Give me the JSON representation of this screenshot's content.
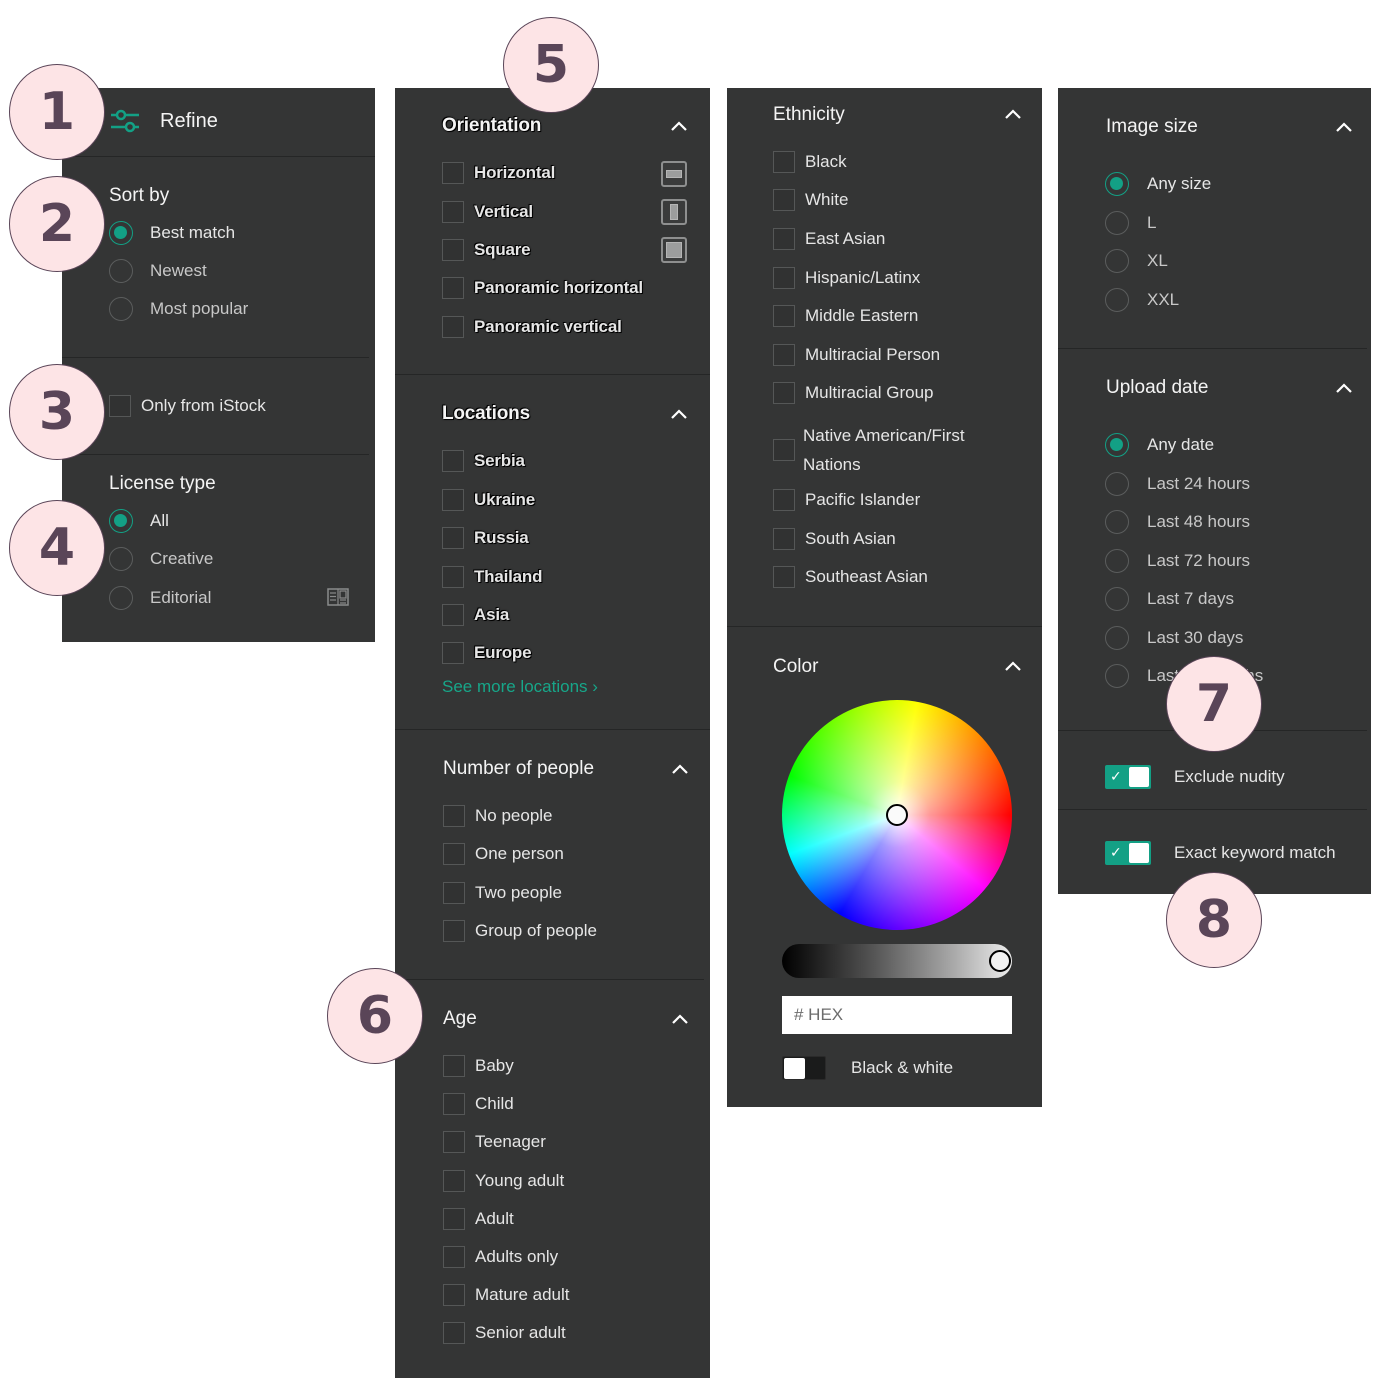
{
  "colors": {
    "accent": "#13a085",
    "panel_bg": "#343535",
    "badge_bg": "#fde4e6",
    "badge_text": "#5a4558",
    "link": "#17a689"
  },
  "badges": [
    "1",
    "2",
    "3",
    "4",
    "5",
    "6",
    "7",
    "8"
  ],
  "refine": {
    "label": "Refine",
    "icon": "sliders-icon"
  },
  "sort_by": {
    "title": "Sort by",
    "options": [
      {
        "label": "Best match",
        "selected": true
      },
      {
        "label": "Newest",
        "selected": false
      },
      {
        "label": "Most popular",
        "selected": false
      }
    ]
  },
  "only_istock": {
    "label": "Only from iStock",
    "checked": false
  },
  "license_type": {
    "title": "License type",
    "options": [
      {
        "label": "All",
        "selected": true
      },
      {
        "label": "Creative",
        "selected": false
      },
      {
        "label": "Editorial",
        "selected": false,
        "icon": "newspaper-icon"
      }
    ]
  },
  "orientation": {
    "title": "Orientation",
    "options": [
      {
        "label": "Horizontal",
        "icon": "horizontal-orientation-icon"
      },
      {
        "label": "Vertical",
        "icon": "vertical-orientation-icon"
      },
      {
        "label": "Square",
        "icon": "square-orientation-icon"
      },
      {
        "label": "Panoramic horizontal"
      },
      {
        "label": "Panoramic vertical"
      }
    ]
  },
  "locations": {
    "title": "Locations",
    "options": [
      "Serbia",
      "Ukraine",
      "Russia",
      "Thailand",
      "Asia",
      "Europe"
    ],
    "see_more": "See more locations ›"
  },
  "number_of_people": {
    "title": "Number of people",
    "options": [
      "No people",
      "One person",
      "Two people",
      "Group of people"
    ]
  },
  "age": {
    "title": "Age",
    "options": [
      "Baby",
      "Child",
      "Teenager",
      "Young adult",
      "Adult",
      "Adults only",
      "Mature adult",
      "Senior adult"
    ]
  },
  "ethnicity": {
    "title": "Ethnicity",
    "options": [
      "Black",
      "White",
      "East Asian",
      "Hispanic/Latinx",
      "Middle Eastern",
      "Multiracial Person",
      "Multiracial Group",
      "Native American/First",
      "Pacific Islander",
      "South Asian",
      "Southeast Asian"
    ],
    "native_line2": "Nations"
  },
  "color": {
    "title": "Color",
    "hex_placeholder": "# HEX",
    "brightness": 1.0,
    "black_white_label": "Black & white",
    "black_white_on": false
  },
  "image_size": {
    "title": "Image size",
    "options": [
      {
        "label": "Any size",
        "selected": true
      },
      {
        "label": "L",
        "selected": false
      },
      {
        "label": "XL",
        "selected": false
      },
      {
        "label": "XXL",
        "selected": false
      }
    ]
  },
  "upload_date": {
    "title": "Upload date",
    "options": [
      {
        "label": "Any date",
        "selected": true
      },
      {
        "label": "Last 24 hours",
        "selected": false
      },
      {
        "label": "Last 48 hours",
        "selected": false
      },
      {
        "label": "Last 72 hours",
        "selected": false
      },
      {
        "label": "Last 7 days",
        "selected": false
      },
      {
        "label": "Last 30 days",
        "selected": false
      },
      {
        "label": "Last 12 months",
        "selected": false
      }
    ]
  },
  "exclude_nudity": {
    "label": "Exclude nudity",
    "on": true
  },
  "exact_keyword": {
    "label": "Exact keyword match",
    "on": true
  }
}
